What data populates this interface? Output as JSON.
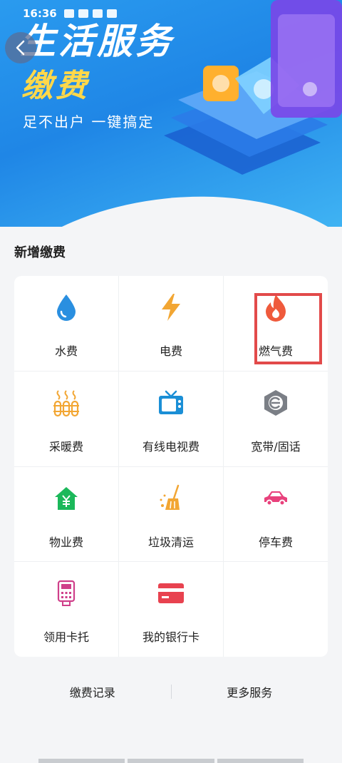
{
  "status_bar": {
    "time": "16:36"
  },
  "banner": {
    "title": "生活服务",
    "subtitle": "缴费",
    "slogan": "足不出户 一键搞定"
  },
  "section": {
    "title": "新增缴费"
  },
  "services": [
    {
      "label": "水费",
      "icon": "water-drop-icon"
    },
    {
      "label": "电费",
      "icon": "lightning-icon"
    },
    {
      "label": "燃气费",
      "icon": "flame-icon"
    },
    {
      "label": "采暖费",
      "icon": "radiator-icon"
    },
    {
      "label": "有线电视费",
      "icon": "tv-icon"
    },
    {
      "label": "宽带/固话",
      "icon": "broadband-icon"
    },
    {
      "label": "物业费",
      "icon": "house-yuan-icon"
    },
    {
      "label": "垃圾清运",
      "icon": "broom-icon"
    },
    {
      "label": "停车费",
      "icon": "car-icon"
    },
    {
      "label": "领用卡托",
      "icon": "card-reader-icon"
    },
    {
      "label": "我的银行卡",
      "icon": "bank-card-icon"
    }
  ],
  "bottom_links": {
    "records": "缴费记录",
    "more": "更多服务"
  },
  "colors": {
    "banner_blue": "#1f86e6",
    "subtitle_yellow": "#ffd84a",
    "highlight_red": "#e24a4a",
    "water_blue": "#2a8fe0",
    "electric_orange": "#f2a633",
    "gas_red": "#ef5a3c",
    "property_green": "#1bb85a",
    "car_pink": "#e8417c",
    "card_red": "#e8424f"
  }
}
